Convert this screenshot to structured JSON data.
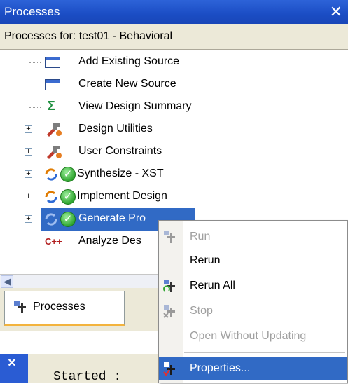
{
  "window": {
    "title": "Processes",
    "close_glyph": "✕"
  },
  "header": {
    "text": "Processes for: test01 - Behavioral"
  },
  "tree": {
    "items": [
      {
        "label": "Add Existing Source",
        "icon": "add-source-icon"
      },
      {
        "label": "Create New Source",
        "icon": "new-source-icon"
      },
      {
        "label": "View Design Summary",
        "icon": "sigma-icon"
      },
      {
        "label": "Design Utilities",
        "icon": "tools-icon"
      },
      {
        "label": "User Constraints",
        "icon": "tools-icon"
      },
      {
        "label": "Synthesize - XST",
        "icon": "refresh-check-icon"
      },
      {
        "label": "Implement Design",
        "icon": "refresh-check-icon"
      },
      {
        "label": "Generate Pro",
        "icon": "refresh-check-icon",
        "selected": true
      },
      {
        "label": "Analyze Des",
        "icon": "cpp-icon"
      }
    ]
  },
  "tabs": {
    "processes_label": "Processes"
  },
  "console": {
    "text": "Started :"
  },
  "context_menu": {
    "items": [
      {
        "label": "Run",
        "disabled": true
      },
      {
        "label": "Rerun",
        "disabled": false
      },
      {
        "label": "Rerun All",
        "disabled": false
      },
      {
        "label": "Stop",
        "disabled": true
      },
      {
        "label": "Open Without Updating",
        "disabled": true
      },
      {
        "label": "Properties...",
        "disabled": false,
        "highlighted": true
      }
    ]
  },
  "colors": {
    "title_blue": "#1b4dc4",
    "selection": "#316ac5",
    "tab_accent": "#f3b33d"
  }
}
